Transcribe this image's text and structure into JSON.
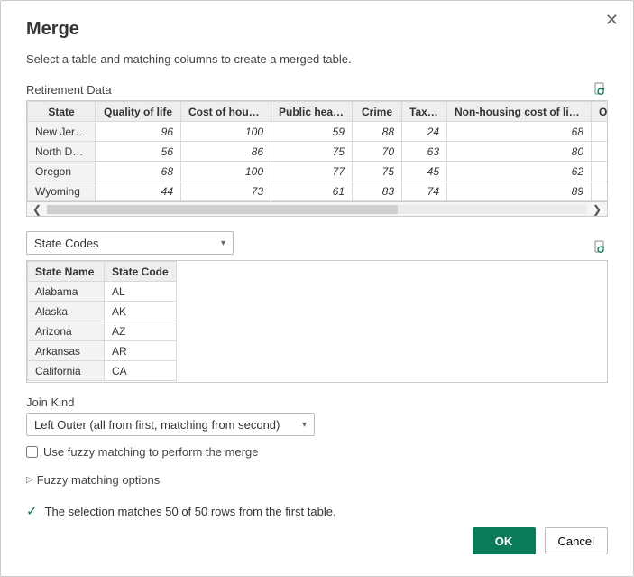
{
  "title": "Merge",
  "subtitle": "Select a table and matching columns to create a merged table.",
  "table1": {
    "name": "Retirement Data",
    "headers": [
      "State",
      "Quality of life",
      "Cost of housing",
      "Public health",
      "Crime",
      "Taxes",
      "Non-housing cost of living",
      "Ov"
    ],
    "rows": [
      [
        "New Jersey",
        "96",
        "100",
        "59",
        "88",
        "24",
        "68"
      ],
      [
        "North Dakota",
        "56",
        "86",
        "75",
        "70",
        "63",
        "80"
      ],
      [
        "Oregon",
        "68",
        "100",
        "77",
        "75",
        "45",
        "62"
      ],
      [
        "Wyoming",
        "44",
        "73",
        "61",
        "83",
        "74",
        "89"
      ]
    ]
  },
  "dropdown2": {
    "value": "State Codes"
  },
  "table2": {
    "headers": [
      "State Name",
      "State Code"
    ],
    "rows": [
      [
        "Alabama",
        "AL"
      ],
      [
        "Alaska",
        "AK"
      ],
      [
        "Arizona",
        "AZ"
      ],
      [
        "Arkansas",
        "AR"
      ],
      [
        "California",
        "CA"
      ]
    ]
  },
  "joinKind": {
    "label": "Join Kind",
    "value": "Left Outer (all from first, matching from second)"
  },
  "fuzzyCheckbox": "Use fuzzy matching to perform the merge",
  "fuzzyExpander": "Fuzzy matching options",
  "status": "The selection matches 50 of 50 rows from the first table.",
  "buttons": {
    "ok": "OK",
    "cancel": "Cancel"
  }
}
